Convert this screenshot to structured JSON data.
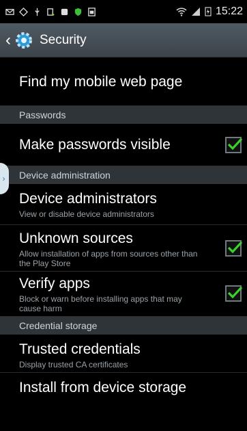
{
  "status": {
    "time": "15:22"
  },
  "actionbar": {
    "title": "Security"
  },
  "rows": [
    {
      "title": "Find my mobile web page"
    },
    {
      "header": "Passwords"
    },
    {
      "title": "Make passwords visible",
      "checked": true
    },
    {
      "header": "Device administration"
    },
    {
      "title": "Device administrators",
      "subtitle": "View or disable device administrators"
    },
    {
      "title": "Unknown sources",
      "subtitle": "Allow installation of apps from sources other than the Play Store",
      "checked": true
    },
    {
      "title": "Verify apps",
      "subtitle": "Block or warn before installing apps that may cause harm",
      "checked": true
    },
    {
      "header": "Credential storage"
    },
    {
      "title": "Trusted credentials",
      "subtitle": "Display trusted CA certificates"
    },
    {
      "title": "Install from device storage"
    }
  ]
}
